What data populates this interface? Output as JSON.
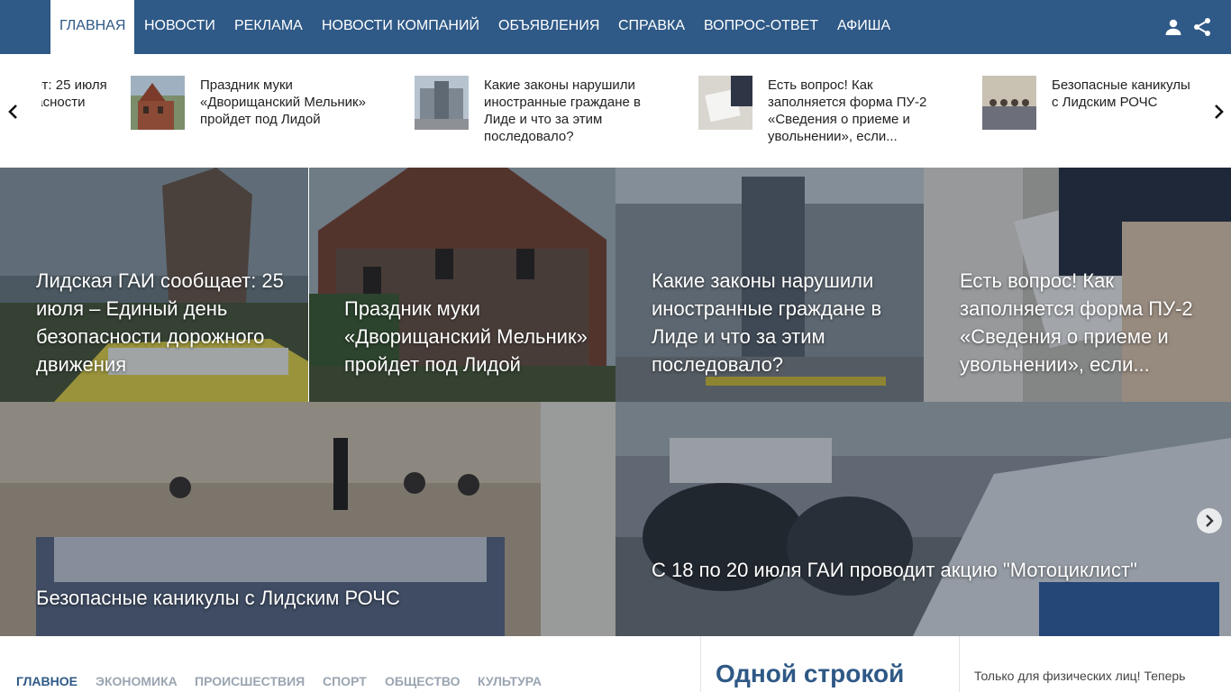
{
  "nav": {
    "items": [
      {
        "label": "Главная",
        "active": true
      },
      {
        "label": "Новости"
      },
      {
        "label": "Реклама"
      },
      {
        "label": "Новости компаний"
      },
      {
        "label": "Объявления"
      },
      {
        "label": "Справка"
      },
      {
        "label": "Вопрос-ответ"
      },
      {
        "label": "Афиша"
      }
    ],
    "icons": [
      "user-icon",
      "share-icon"
    ]
  },
  "ticker": {
    "items": [
      {
        "text": "Лидская ГАИ сообщает: 25 июля – Единый день безопасности дорожного движения"
      },
      {
        "text": "Праздник муки «Дворищанский Мельник» пройдет под Лидой"
      },
      {
        "text": "Какие законы нарушили иностранные граждане в Лиде и что за этим последовало?"
      },
      {
        "text": "Есть вопрос! Как заполняется форма ПУ-2 «Сведения о приеме и увольнении», если..."
      },
      {
        "text": "Безопасные каникулы с Лидским РОЧС"
      }
    ],
    "icons": [
      "chevron-left-icon",
      "chevron-right-icon"
    ]
  },
  "hero": {
    "cards": [
      {
        "title": "Лидская ГАИ сообщает: 25 июля – Единый день безопасности дорожного движения"
      },
      {
        "title": "Праздник муки «Дворищанский Мельник» пройдет под Лидой"
      },
      {
        "title": "Какие законы нарушили иностранные граждане в Лиде и что за этим последовало?"
      },
      {
        "title": "Есть вопрос! Как заполняется форма ПУ-2 «Сведения о приеме и увольнении», если..."
      },
      {
        "title": "Безопасные каникулы с Лидским РОЧС"
      },
      {
        "title": "С 18 по 20 июля ГАИ проводит акцию \"Мотоциклист\""
      }
    ],
    "icons": [
      "chevron-right-icon"
    ]
  },
  "categories": {
    "tabs": [
      {
        "label": "Главное",
        "active": true
      },
      {
        "label": "Экономика"
      },
      {
        "label": "Происшествия"
      },
      {
        "label": "Спорт"
      },
      {
        "label": "Общество"
      },
      {
        "label": "Культура"
      }
    ]
  },
  "one_line": {
    "title": "Одной строкой"
  },
  "side_news": {
    "text": "Только для физических лиц! Теперь"
  },
  "colors": {
    "brand": "#2f5986",
    "tab_inactive": "#9aa5b1"
  }
}
